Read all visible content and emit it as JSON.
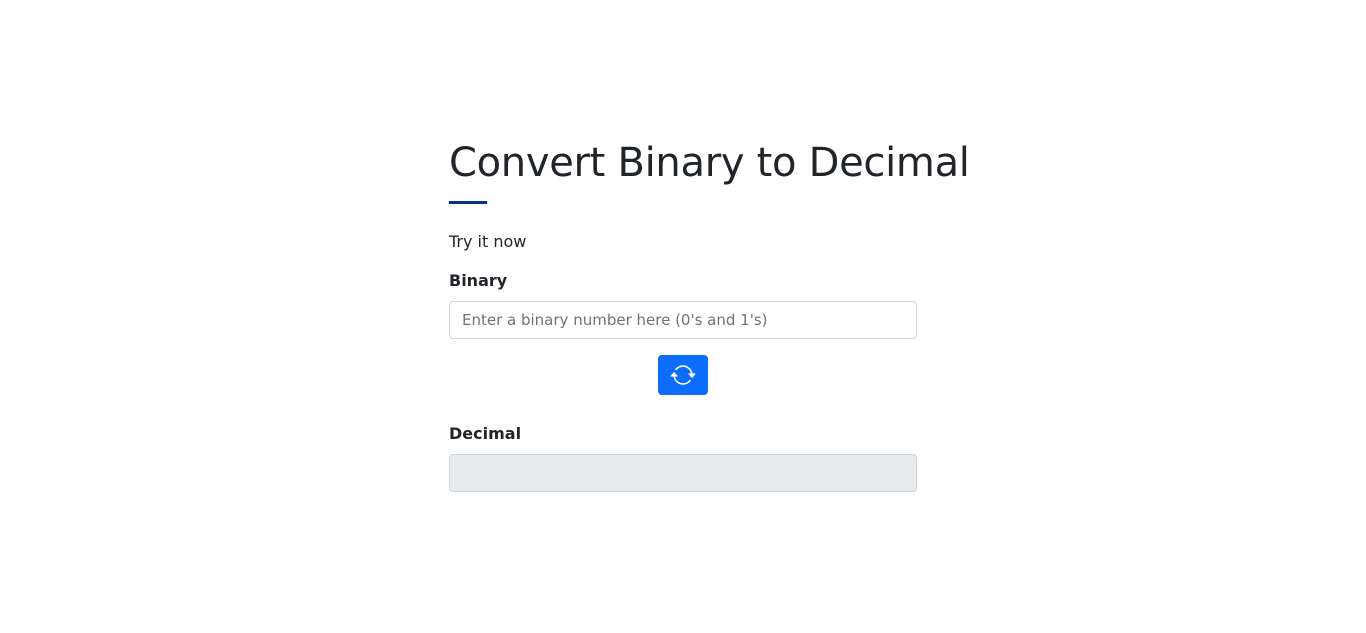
{
  "page": {
    "title": "Convert Binary to Decimal",
    "intro": "Try it now"
  },
  "binary": {
    "label": "Binary",
    "placeholder": "Enter a binary number here (0's and 1's)",
    "value": ""
  },
  "convert_button": {
    "icon": "refresh-icon",
    "color": "#0d6efd"
  },
  "decimal": {
    "label": "Decimal",
    "value": ""
  },
  "colors": {
    "accent_rule": "#0b2e8a",
    "button": "#0d6efd",
    "readonly_field": "#e9ecef"
  }
}
